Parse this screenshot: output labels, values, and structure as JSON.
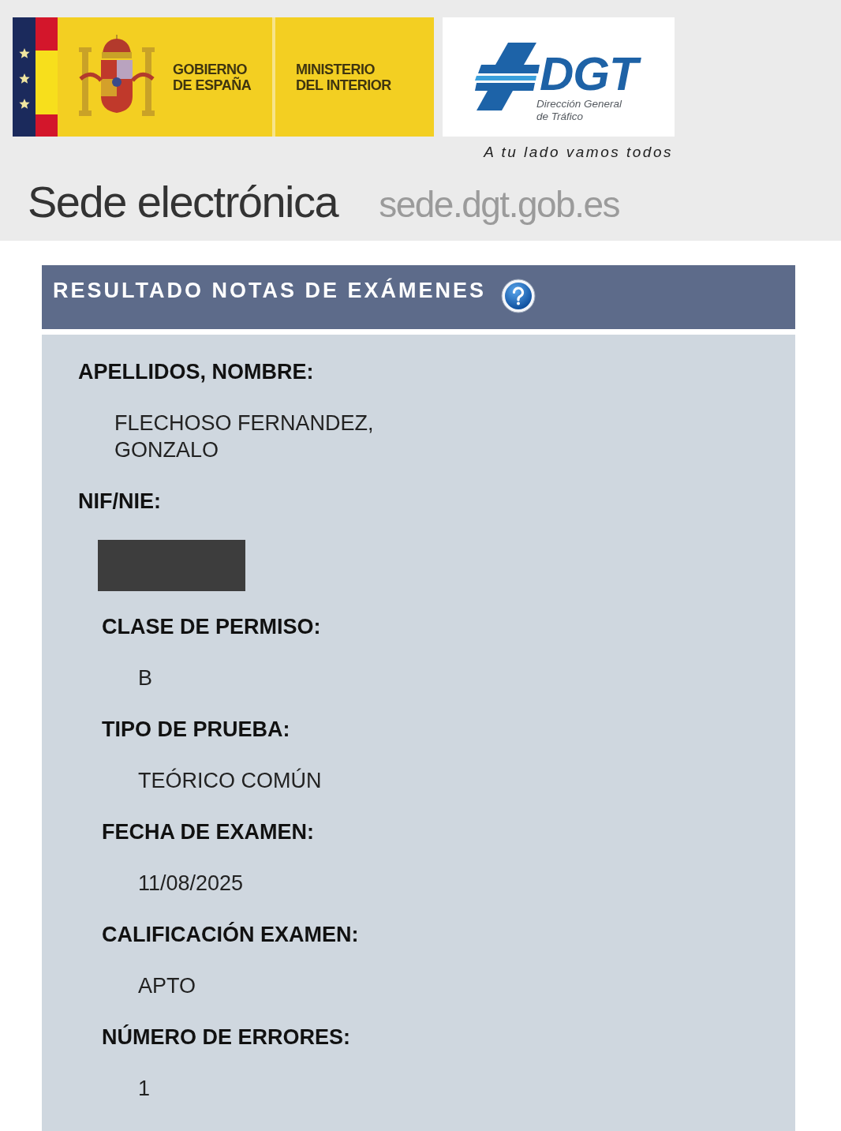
{
  "header": {
    "government_logo": {
      "lines": [
        "GOBIERNO",
        "DE ESPAÑA"
      ]
    },
    "ministry_logo": {
      "lines": [
        "MINISTERIO",
        "DEL INTERIOR"
      ]
    },
    "dgt_logo": {
      "acronym": "DGT",
      "full_name_lines": [
        "Dirección General",
        "de Tráfico"
      ]
    },
    "slogan": "A tu lado vamos todos",
    "site_title": "Sede electrónica",
    "site_url": "sede.dgt.gob.es"
  },
  "panel": {
    "title": "RESULTADO NOTAS DE EXÁMENES"
  },
  "fields": [
    {
      "label": "APELLIDOS, NOMBRE:",
      "value": "FLECHOSO FERNANDEZ, GONZALO"
    },
    {
      "label": "NIF/NIE:",
      "redacted": true,
      "children": [
        {
          "label": "CLASE DE PERMISO:",
          "value": "B"
        },
        {
          "label": "TIPO DE PRUEBA:",
          "value": "TEÓRICO COMÚN"
        },
        {
          "label": "FECHA DE EXAMEN:",
          "value": "11/08/2025"
        },
        {
          "label": "CALIFICACIÓN EXAMEN:",
          "value": "APTO"
        },
        {
          "label": "NÚMERO DE ERRORES:",
          "value": "1"
        }
      ]
    }
  ]
}
